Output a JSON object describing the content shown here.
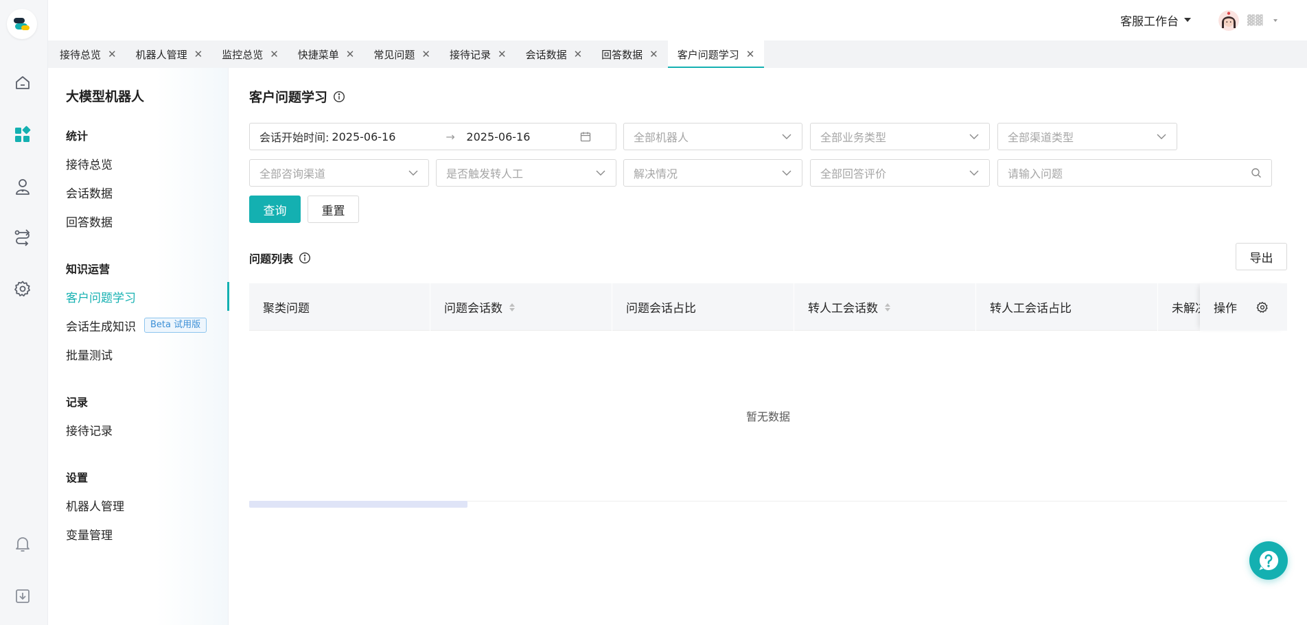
{
  "header": {
    "workspace_label": "客服工作台",
    "user_name": "▓▓"
  },
  "tabs": [
    {
      "label": "接待总览",
      "active": false
    },
    {
      "label": "机器人管理",
      "active": false
    },
    {
      "label": "监控总览",
      "active": false
    },
    {
      "label": "快捷菜单",
      "active": false
    },
    {
      "label": "常见问题",
      "active": false
    },
    {
      "label": "接待记录",
      "active": false
    },
    {
      "label": "会话数据",
      "active": false
    },
    {
      "label": "回答数据",
      "active": false
    },
    {
      "label": "客户问题学习",
      "active": true
    }
  ],
  "tab_close_glyph": "✕",
  "sidebar": {
    "title": "大模型机器人",
    "groups": [
      {
        "label": "统计",
        "items": [
          "接待总览",
          "会话数据",
          "回答数据"
        ]
      },
      {
        "label": "知识运营",
        "items": [
          "客户问题学习",
          "会话生成知识",
          "批量测试"
        ]
      },
      {
        "label": "记录",
        "items": [
          "接待记录"
        ]
      },
      {
        "label": "设置",
        "items": [
          "机器人管理",
          "变量管理"
        ]
      }
    ],
    "active_item": "客户问题学习",
    "beta_badge": "Beta 试用版"
  },
  "page": {
    "title": "客户问题学习",
    "filters": {
      "date_label": "会话开始时间:",
      "date_start": "2025-06-16",
      "date_end": "2025-06-16",
      "date_arrow": "→",
      "robot_placeholder": "全部机器人",
      "business_placeholder": "全部业务类型",
      "channel_type_placeholder": "全部渠道类型",
      "consult_channel_placeholder": "全部咨询渠道",
      "transfer_placeholder": "是否触发转人工",
      "resolution_placeholder": "解决情况",
      "rating_placeholder": "全部回答评价",
      "question_placeholder": "请输入问题"
    },
    "query_button": "查询",
    "reset_button": "重置",
    "list_title": "问题列表",
    "export_button": "导出",
    "table": {
      "columns": [
        "聚类问题",
        "问题会话数",
        "问题会话占比",
        "转人工会话数",
        "转人工会话占比",
        "未解决"
      ],
      "operation_column": "操作",
      "empty_text": "暂无数据"
    }
  },
  "colors": {
    "accent": "#14b0b1",
    "beta_border": "#8cc4ee",
    "beta_text": "#3b8fd6"
  }
}
